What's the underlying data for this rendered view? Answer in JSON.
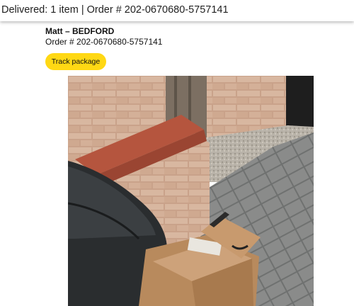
{
  "window": {
    "title": "Delivered: 1 item | Order # 202-0670680-5757141"
  },
  "delivery": {
    "recipient": "Matt – BEDFORD",
    "order_number": "Order # 202-0670680-5757141",
    "track_button_label": "Track package",
    "track_button_color": "#ffd814"
  },
  "photo": {
    "description_icon": "delivery-photo"
  }
}
